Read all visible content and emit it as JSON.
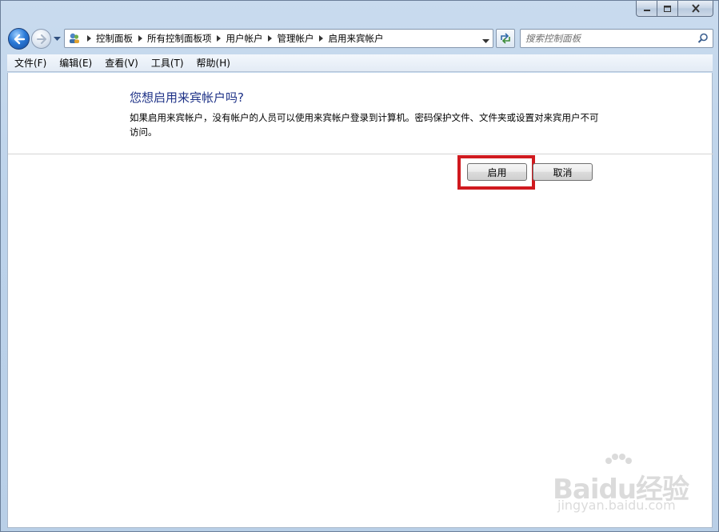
{
  "window": {
    "caption_buttons": [
      "minimize-icon",
      "maximize-icon",
      "close-icon"
    ]
  },
  "navigation": {
    "back_icon": "back-arrow-icon",
    "forward_icon": "forward-arrow-icon",
    "breadcrumb": [
      "控制面板",
      "所有控制面板项",
      "用户帐户",
      "管理帐户",
      "启用来宾帐户"
    ],
    "search_placeholder": "搜索控制面板"
  },
  "menu": {
    "items": [
      "文件(F)",
      "编辑(E)",
      "查看(V)",
      "工具(T)",
      "帮助(H)"
    ]
  },
  "dialog": {
    "question": "您想启用来宾帐户吗?",
    "description": "如果启用来宾帐户，没有帐户的人员可以使用来宾帐户登录到计算机。密码保护文件、文件夹或设置对来宾用户不可访问。",
    "enable_label": "启用",
    "cancel_label": "取消"
  },
  "colors": {
    "heading": "#1e3287",
    "highlight_box": "#d01a1f"
  },
  "watermark": {
    "brand": "Baidu经验",
    "site": "jingyan.baidu.com"
  }
}
